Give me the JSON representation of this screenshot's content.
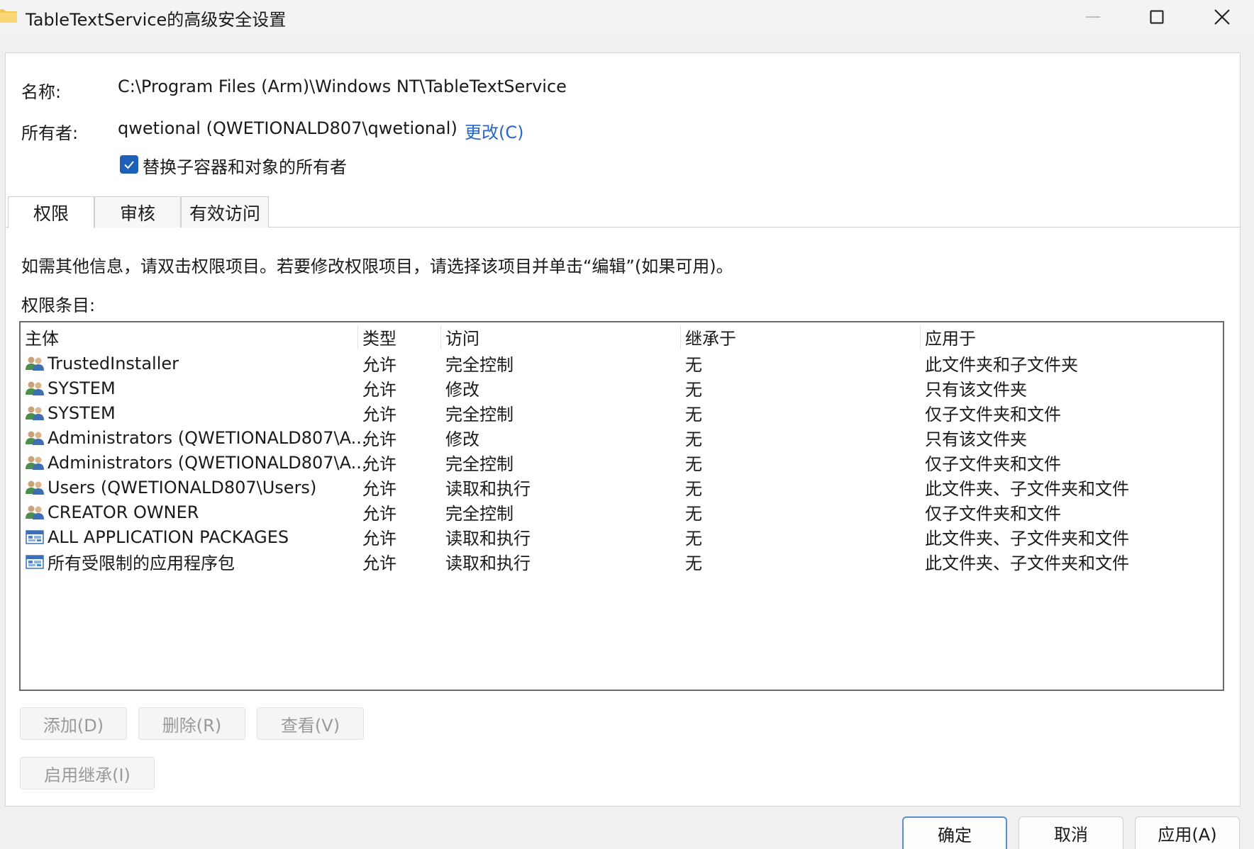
{
  "window": {
    "title": "TableTextService的高级安全设置",
    "icon": "folder-icon",
    "controls": [
      "minimize-icon",
      "maximize-icon",
      "close-icon"
    ]
  },
  "name_label": "名称:",
  "name_value": "C:\\Program Files (Arm)\\Windows NT\\TableTextService",
  "owner_label": "所有者:",
  "owner_value": "qwetional (QWETIONALD807\\qwetional)",
  "owner_change": "更改(C)",
  "replace_owner": {
    "label": "替换子容器和对象的所有者",
    "checked": true
  },
  "tabs": [
    "权限",
    "审核",
    "有效访问"
  ],
  "active_tab": 0,
  "info_text": "如需其他信息，请双击权限项目。若要修改权限项目，请选择该项目并单击“编辑”(如果可用)。",
  "entries_label": "权限条目:",
  "columns": [
    "主体",
    "类型",
    "访问",
    "继承于",
    "应用于"
  ],
  "rows": [
    {
      "principal": "TrustedInstaller",
      "icon": "user-group-icon",
      "type": "允许",
      "access": "完全控制",
      "inherited": "无",
      "applies": "此文件夹和子文件夹"
    },
    {
      "principal": "SYSTEM",
      "icon": "user-group-icon",
      "type": "允许",
      "access": "修改",
      "inherited": "无",
      "applies": "只有该文件夹"
    },
    {
      "principal": "SYSTEM",
      "icon": "user-group-icon",
      "type": "允许",
      "access": "完全控制",
      "inherited": "无",
      "applies": "仅子文件夹和文件"
    },
    {
      "principal": "Administrators (QWETIONALD807\\A...",
      "icon": "user-group-icon",
      "type": "允许",
      "access": "修改",
      "inherited": "无",
      "applies": "只有该文件夹"
    },
    {
      "principal": "Administrators (QWETIONALD807\\A...",
      "icon": "user-group-icon",
      "type": "允许",
      "access": "完全控制",
      "inherited": "无",
      "applies": "仅子文件夹和文件"
    },
    {
      "principal": "Users (QWETIONALD807\\Users)",
      "icon": "user-group-icon",
      "type": "允许",
      "access": "读取和执行",
      "inherited": "无",
      "applies": "此文件夹、子文件夹和文件"
    },
    {
      "principal": "CREATOR OWNER",
      "icon": "user-group-icon",
      "type": "允许",
      "access": "完全控制",
      "inherited": "无",
      "applies": "仅子文件夹和文件"
    },
    {
      "principal": "ALL APPLICATION PACKAGES",
      "icon": "app-package-icon",
      "type": "允许",
      "access": "读取和执行",
      "inherited": "无",
      "applies": "此文件夹、子文件夹和文件"
    },
    {
      "principal": "所有受限制的应用程序包",
      "icon": "app-package-icon",
      "type": "允许",
      "access": "读取和执行",
      "inherited": "无",
      "applies": "此文件夹、子文件夹和文件"
    }
  ],
  "buttons": {
    "add": "添加(D)",
    "remove": "删除(R)",
    "view": "查看(V)",
    "enable_inheritance": "启用继承(I)"
  },
  "dialog_buttons": {
    "ok": "确定",
    "cancel": "取消",
    "apply": "应用(A)"
  },
  "colors": {
    "accent": "#1f5fb8",
    "link": "#2a66c6",
    "disabled_text": "#9a9a9a"
  }
}
